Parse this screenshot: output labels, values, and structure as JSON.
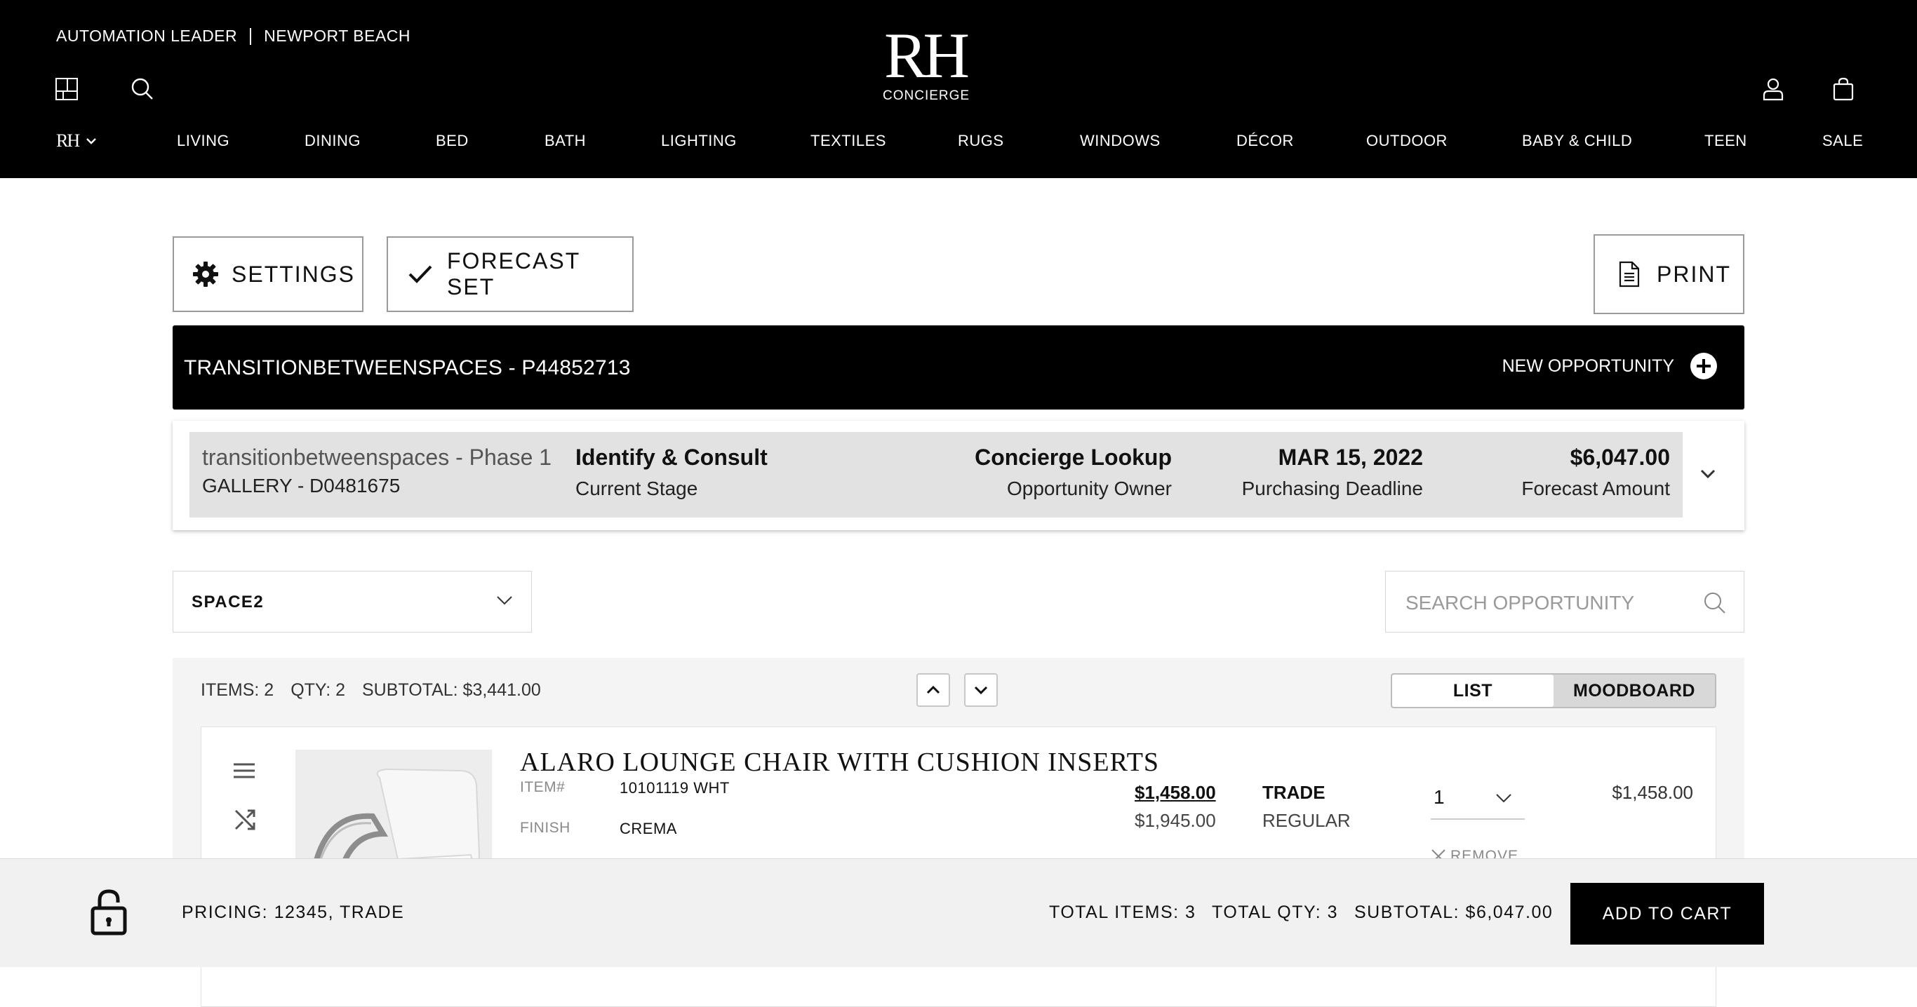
{
  "header": {
    "role": "AUTOMATION LEADER",
    "location": "NEWPORT BEACH",
    "logo_text": "RH",
    "logo_sub": "CONCIERGE",
    "brand_menu_label": "RH",
    "nav": [
      "LIVING",
      "DINING",
      "BED",
      "BATH",
      "LIGHTING",
      "TEXTILES",
      "RUGS",
      "WINDOWS",
      "DÉCOR",
      "OUTDOOR",
      "BABY & CHILD",
      "TEEN",
      "SALE"
    ]
  },
  "toolbar": {
    "settings_label": "SETTINGS",
    "forecast_label": "FORECAST SET",
    "print_label": "PRINT"
  },
  "project": {
    "title": "TRANSITIONBETWEENSPACES - P44852713",
    "new_opportunity_label": "NEW OPPORTUNITY"
  },
  "opportunity": {
    "name": "transitionbetweenspaces - Phase 1",
    "gallery": "GALLERY - D0481675",
    "stage": "Identify & Consult",
    "stage_label": "Current Stage",
    "owner": "Concierge Lookup",
    "owner_label": "Opportunity Owner",
    "deadline": "MAR 15, 2022",
    "deadline_label": "Purchasing Deadline",
    "forecast": "$6,047.00",
    "forecast_label": "Forecast Amount"
  },
  "space": {
    "selected": "SPACE2"
  },
  "search": {
    "placeholder": "SEARCH OPPORTUNITY"
  },
  "summary": {
    "items": "ITEMS: 2",
    "qty": "QTY: 2",
    "subtotal": "SUBTOTAL: $3,441.00"
  },
  "view_toggle": {
    "list": "LIST",
    "moodboard": "MOODBOARD",
    "selected": "LIST"
  },
  "item": {
    "title": "ALARO LOUNGE CHAIR WITH CUSHION INSERTS",
    "item_label": "ITEM#",
    "item_number": "10101119 WHT",
    "finish_label": "FINISH",
    "finish": "CREMA",
    "trade_price": "$1,458.00",
    "regular_price": "$1,945.00",
    "trade_label": "TRADE",
    "regular_label": "REGULAR",
    "quantity": "1",
    "remove_label": "REMOVE",
    "line_total": "$1,458.00"
  },
  "footer": {
    "pricing": "PRICING: 12345, TRADE",
    "total_items": "TOTAL ITEMS: 3",
    "total_qty": "TOTAL QTY: 3",
    "subtotal": "SUBTOTAL: $6,047.00",
    "add_to_cart": "ADD TO CART"
  }
}
